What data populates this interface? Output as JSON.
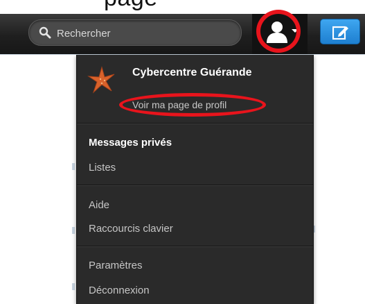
{
  "header": {
    "cropped_title": "page"
  },
  "navbar": {
    "search": {
      "placeholder": "Rechercher"
    }
  },
  "dropdown": {
    "profile": {
      "name": "Cybercentre Guérande",
      "view_profile_link": "Voir ma page de profil"
    },
    "groups": [
      {
        "items": [
          {
            "label": "Messages privés",
            "emphasis": true
          },
          {
            "label": "Listes",
            "emphasis": false
          }
        ]
      },
      {
        "items": [
          {
            "label": "Aide",
            "emphasis": false
          },
          {
            "label": "Raccourcis clavier",
            "emphasis": false
          }
        ]
      },
      {
        "items": [
          {
            "label": "Paramètres",
            "emphasis": false
          },
          {
            "label": "Déconnexion",
            "emphasis": false
          }
        ]
      }
    ]
  },
  "icons": {
    "search": "search-icon",
    "user": "user-icon",
    "caret": "caret-down-icon",
    "compose": "compose-icon",
    "avatar": "starfish-avatar"
  },
  "colors": {
    "navbar": "#1f1f1f",
    "dropdown": "#2a2a2a",
    "compose_button": "#2c8fe0",
    "highlight": "#e8141c"
  }
}
